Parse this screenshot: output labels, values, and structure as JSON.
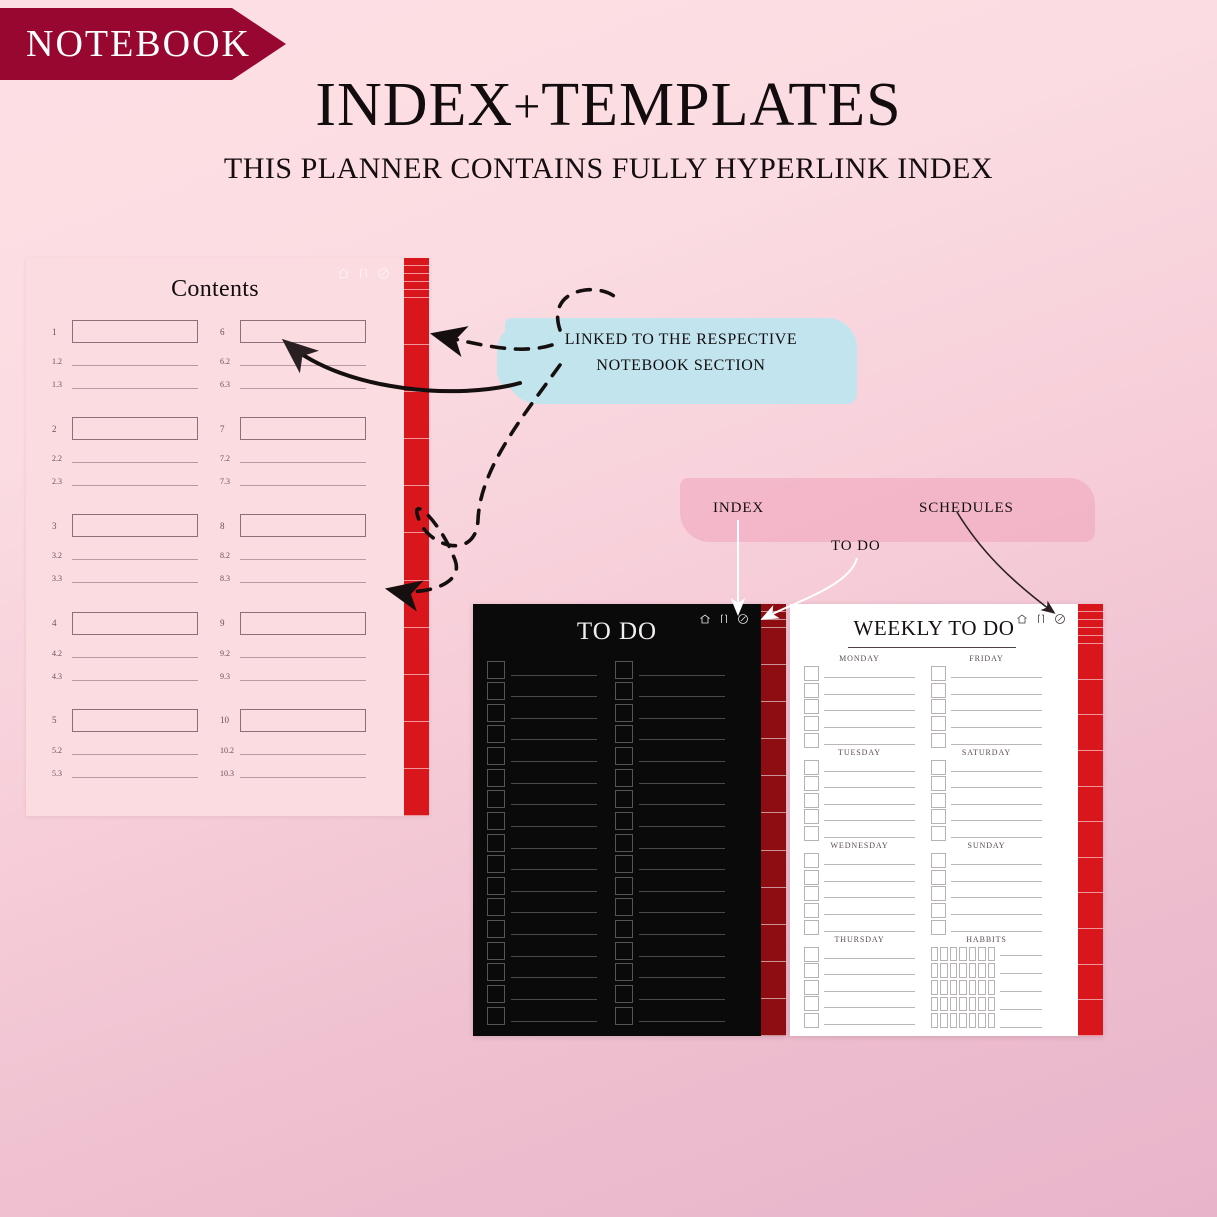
{
  "ribbon": {
    "label": "NOTEBOOK"
  },
  "header": {
    "title_left": "INDEX",
    "title_plus": "+",
    "title_right": "TEMPLATES",
    "subtitle": "THIS PLANNER CONTAINS FULLY HYPERLINK INDEX"
  },
  "colors": {
    "ribbon_bg": "#97072f",
    "tab_red": "#d8161c",
    "tab_red_dark": "#8e0d12",
    "blue_brush": "#bfe5ee",
    "pink_brush": "#f0a8be",
    "page_pink": "#fbdce1",
    "page_black": "#0a0a0a",
    "page_white": "#ffffff",
    "text_dark": "#140d0f"
  },
  "annotations": {
    "blue_note_line1": "LINKED TO THE RESPECTIVE",
    "blue_note_line2": "NOTEBOOK SECTION",
    "label_index": "INDEX",
    "label_todo": "TO DO",
    "label_schedules": "SCHEDULES"
  },
  "page_icons": [
    {
      "name": "home-icon",
      "glyph": "home"
    },
    {
      "name": "bookmark-icon",
      "glyph": "bookmark"
    },
    {
      "name": "pen-circle-icon",
      "glyph": "pen"
    }
  ],
  "contents_page": {
    "title": "Contents",
    "entries": [
      {
        "num": "1",
        "sub": [
          "1.2",
          "1.3"
        ]
      },
      {
        "num": "6",
        "sub": [
          "6.2",
          "6.3"
        ]
      },
      {
        "num": "2",
        "sub": [
          "2.2",
          "2.3"
        ]
      },
      {
        "num": "7",
        "sub": [
          "7.2",
          "7.3"
        ]
      },
      {
        "num": "3",
        "sub": [
          "3.2",
          "3.3"
        ]
      },
      {
        "num": "8",
        "sub": [
          "8.2",
          "8.3"
        ]
      },
      {
        "num": "4",
        "sub": [
          "4.2",
          "4.3"
        ]
      },
      {
        "num": "9",
        "sub": [
          "9.2",
          "9.3"
        ]
      },
      {
        "num": "5",
        "sub": [
          "5.2",
          "5.3"
        ]
      },
      {
        "num": "10",
        "sub": [
          "10.2",
          "10.3"
        ]
      }
    ],
    "tab_count": 11,
    "mini_tab_count": 5
  },
  "todo_page": {
    "title": "TO DO",
    "columns": 2,
    "rows_per_column": 17,
    "tab_count": 11,
    "mini_tab_count": 3
  },
  "weekly_page": {
    "title": "WEEKLY TO DO",
    "tab_count": 11,
    "mini_tab_count": 5,
    "cells": [
      {
        "label": "MONDAY",
        "rows": 5,
        "type": "lines"
      },
      {
        "label": "FRIDAY",
        "rows": 5,
        "type": "lines"
      },
      {
        "label": "TUESDAY",
        "rows": 5,
        "type": "lines"
      },
      {
        "label": "SATURDAY",
        "rows": 5,
        "type": "lines"
      },
      {
        "label": "WEDNESDAY",
        "rows": 5,
        "type": "lines"
      },
      {
        "label": "SUNDAY",
        "rows": 5,
        "type": "lines"
      },
      {
        "label": "THURSDAY",
        "rows": 5,
        "type": "lines"
      },
      {
        "label": "HABBITS",
        "rows": 5,
        "type": "habits",
        "habit_cols": 7,
        "habit_rows": 5
      }
    ]
  }
}
